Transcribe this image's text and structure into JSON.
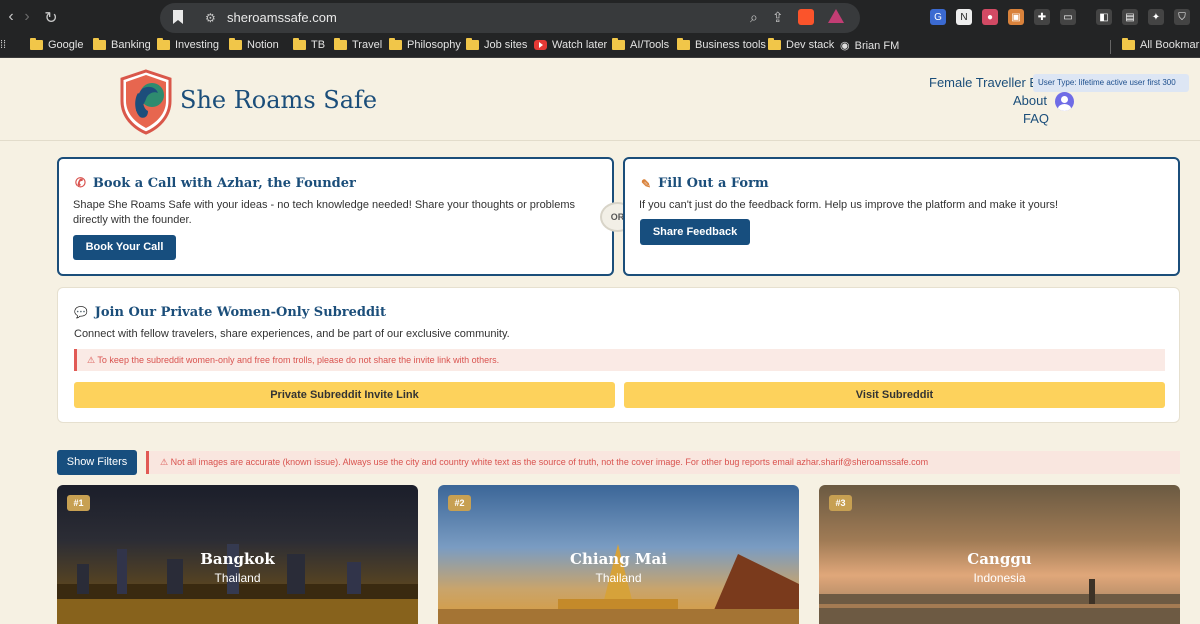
{
  "browser": {
    "url": "sheroamssafe.com",
    "bookmarks": [
      "Google",
      "Banking",
      "Investing",
      "Notion",
      "TB",
      "Travel",
      "Philosophy",
      "Job sites",
      "Watch later",
      "AI/Tools",
      "Business tools",
      "Dev stack",
      "Brian FM",
      "All Bookmarks"
    ]
  },
  "header": {
    "brand": "She Roams Safe",
    "nav": [
      "Female Traveller Bl",
      "About",
      "FAQ"
    ],
    "user_type": "User Type: lifetime active user first 300"
  },
  "call_card": {
    "title": "Book a Call with Azhar, the Founder",
    "description": "Shape She Roams Safe with your ideas - no tech knowledge needed! Share your thoughts or problems directly with the founder.",
    "button": "Book Your Call"
  },
  "or_label": "OR",
  "form_card": {
    "title": "Fill Out a Form",
    "description": "If you can't just do the feedback form. Help us improve the platform and make it yours!",
    "button": "Share Feedback"
  },
  "reddit_card": {
    "title": "Join Our Private Women-Only Subreddit",
    "description": "Connect with fellow travelers, share experiences, and be part of our exclusive community.",
    "warning": "To keep the subreddit women-only and free from trolls, please do not share the invite link with others.",
    "invite_button": "Private Subreddit Invite Link",
    "visit_button": "Visit Subreddit"
  },
  "filters_button": "Show Filters",
  "image_warning": "Not all images are accurate (known issue). Always use the city and country white text as the source of truth, not the cover image. For other bug reports email azhar.sharif@sheroamssafe.com",
  "cities": [
    {
      "rank": "#1",
      "city": "Bangkok",
      "country": "Thailand"
    },
    {
      "rank": "#2",
      "city": "Chiang Mai",
      "country": "Thailand"
    },
    {
      "rank": "#3",
      "city": "Canggu",
      "country": "Indonesia"
    }
  ]
}
